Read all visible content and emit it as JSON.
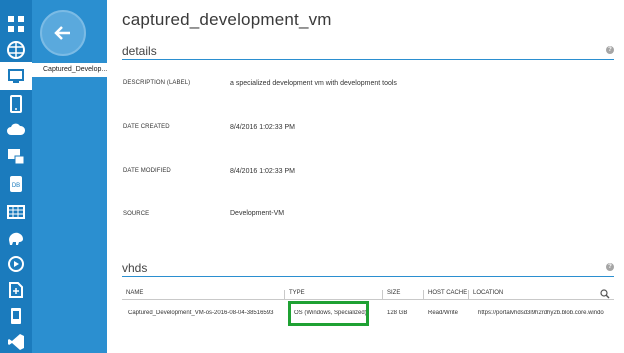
{
  "rail": {
    "icons": [
      {
        "name": "all-items-icon"
      },
      {
        "name": "web-sites-icon"
      },
      {
        "name": "virtual-machines-icon"
      },
      {
        "name": "mobile-services-icon"
      },
      {
        "name": "cloud-services-icon"
      },
      {
        "name": "batch-icon"
      },
      {
        "name": "sql-databases-icon"
      },
      {
        "name": "storage-icon"
      },
      {
        "name": "hdinsight-icon"
      },
      {
        "name": "media-services-icon"
      },
      {
        "name": "service-bus-icon"
      },
      {
        "name": "mobile-engagement-icon"
      },
      {
        "name": "visual-studio-icon"
      }
    ],
    "accent": "#1b7bbd"
  },
  "panel": {
    "item_label": "Captured_Develop..."
  },
  "page": {
    "title": "captured_development_vm"
  },
  "details": {
    "heading": "details",
    "help": "?",
    "rows": [
      {
        "label": "DESCRIPTION (LABEL)",
        "value": "a specialized development vm with development tools"
      },
      {
        "label": "DATE CREATED",
        "value": "8/4/2016 1:02:33 PM"
      },
      {
        "label": "DATE MODIFIED",
        "value": "8/4/2016 1:02:33 PM"
      },
      {
        "label": "SOURCE",
        "value": "Development-VM"
      }
    ]
  },
  "vhds": {
    "heading": "vhds",
    "help": "?",
    "columns": [
      "NAME",
      "TYPE",
      "SIZE",
      "HOST CACHE",
      "LOCATION"
    ],
    "rows": [
      {
        "name": "Captured_Development_VM-os-2016-08-04-38516593",
        "type": "OS (Windows, Specialized)",
        "size": "128 GB",
        "host_cache": "Read/Write",
        "location": "https://portalvhdsd3l9h2rdhy2b.blob.core.windo"
      }
    ],
    "highlight_color": "#1fa133"
  }
}
